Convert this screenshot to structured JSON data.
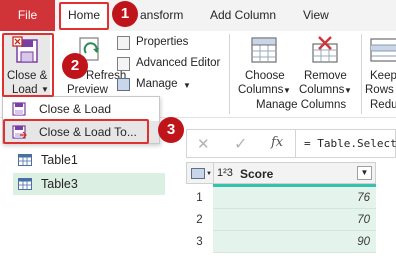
{
  "ribbon_tabs": {
    "file": "File",
    "home": "Home",
    "transform": "ansform",
    "add_column": "Add Column",
    "view": "View"
  },
  "ribbon": {
    "close_load_line1": "Close &",
    "close_load_line2": "Load",
    "refresh_preview_line1": "Refresh",
    "refresh_preview_line2": "Preview",
    "properties": "Properties",
    "advanced_editor": "Advanced Editor",
    "manage": "Manage",
    "choose_columns_line1": "Choose",
    "choose_columns_line2": "Columns",
    "remove_columns_line1": "Remove",
    "remove_columns_line2": "Columns",
    "manage_columns_group": "Manage Columns",
    "keep_rows_line1": "Keep",
    "keep_rows_line2": "Rows",
    "reduce_group": "Redu"
  },
  "menu": {
    "items": [
      "Close & Load",
      "Close & Load To..."
    ]
  },
  "queries": [
    "Table1",
    "Table3"
  ],
  "formula": {
    "fx": "fx",
    "text": "= Table.Select"
  },
  "grid": {
    "type_icon": "1²3",
    "column_header": "Score",
    "rows": [
      {
        "index": "1",
        "score": "76"
      },
      {
        "index": "2",
        "score": "70"
      },
      {
        "index": "3",
        "score": "90"
      }
    ]
  },
  "badges": [
    "1",
    "2",
    "3"
  ],
  "colors": {
    "file_tab": "#d13438",
    "highlight": "#e03030",
    "badge": "#c0141b",
    "selected_query": "#dcefe3",
    "cell_bg": "#e4f3ec",
    "quality_bar": "#33c3b0"
  }
}
